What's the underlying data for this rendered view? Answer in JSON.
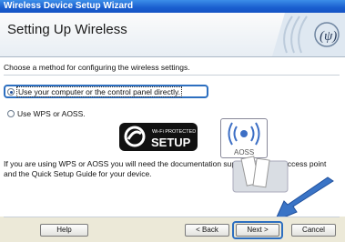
{
  "window": {
    "title": "Wireless Device Setup Wizard"
  },
  "header": {
    "title": "Setting Up Wireless"
  },
  "body": {
    "instruction": "Choose a method for configuring the wireless settings.",
    "option_computer": "Use your computer or the control panel directly.",
    "option_wps": "Use WPS or AOSS.",
    "wps_logo_small": "Wi-Fi PROTECTED",
    "wps_logo_big": "SETUP",
    "aoss_label": "AOSS",
    "info": "If you are using WPS or AOSS you will need the documentation supplied with the access point and the Quick Setup Guide for your device."
  },
  "footer": {
    "help": "Help",
    "back": "< Back",
    "next": "Next >",
    "cancel": "Cancel"
  },
  "colors": {
    "titlebar": "#1a5fcf",
    "highlight": "#2d6fc0",
    "arrow": "#3a74c6"
  }
}
